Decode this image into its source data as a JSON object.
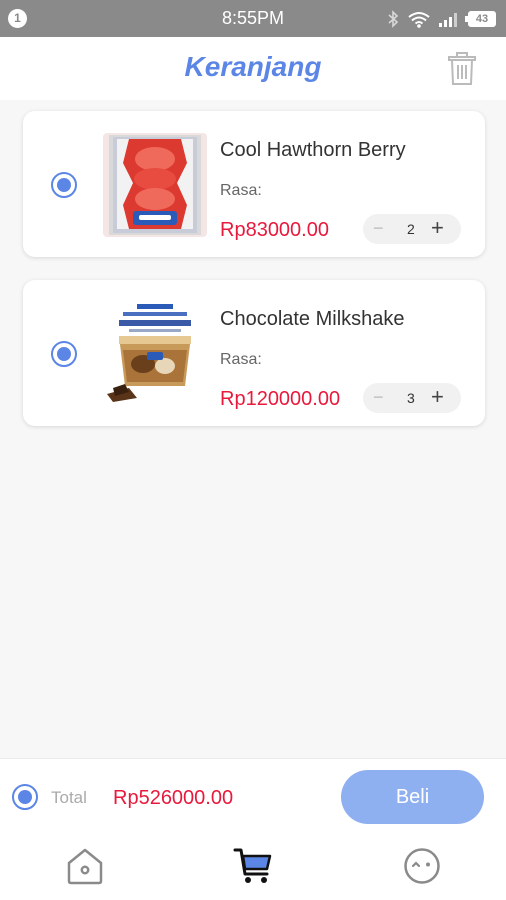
{
  "status_bar": {
    "notification_count": "1",
    "time": "8:55PM",
    "battery": "43",
    "icons": [
      "bluetooth-icon",
      "wifi-icon",
      "signal-icon",
      "battery-icon"
    ]
  },
  "header": {
    "title": "Keranjang",
    "delete_icon": "trash-icon"
  },
  "cart": {
    "items": [
      {
        "name": "Cool Hawthorn Berry",
        "rasa_label": "Rasa:",
        "price": "Rp83000.00",
        "quantity": "2",
        "selected": true,
        "minus": "−",
        "plus": "+"
      },
      {
        "name": "Chocolate Milkshake",
        "rasa_label": "Rasa:",
        "price": "Rp120000.00",
        "quantity": "3",
        "selected": true,
        "minus": "−",
        "plus": "+"
      }
    ]
  },
  "footer": {
    "total_label": "Total",
    "total_value": "Rp526000.00",
    "buy_label": "Beli",
    "select_all": true
  },
  "bottom_nav": {
    "items": [
      "home-icon",
      "cart-icon",
      "profile-icon"
    ],
    "active": "cart-icon"
  },
  "colors": {
    "accent": "#5b86e6",
    "button": "#8fb0f0",
    "price": "#e8193c"
  }
}
